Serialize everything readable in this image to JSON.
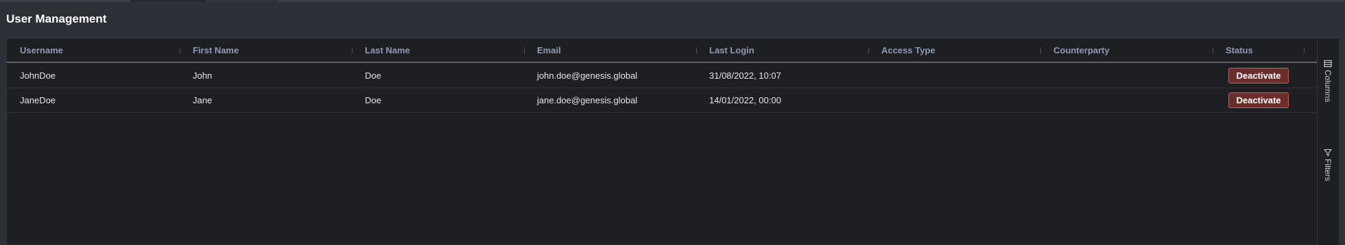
{
  "page": {
    "title": "User Management"
  },
  "grid": {
    "columns": [
      "Username",
      "First Name",
      "Last Name",
      "Email",
      "Last Login",
      "Access Type",
      "Counterparty",
      "Status"
    ],
    "rows": [
      {
        "username": "JohnDoe",
        "first_name": "John",
        "last_name": "Doe",
        "email": "john.doe@genesis.global",
        "last_login": "31/08/2022, 10:07",
        "access_type": "",
        "counterparty": "",
        "status_action": "Deactivate"
      },
      {
        "username": "JaneDoe",
        "first_name": "Jane",
        "last_name": "Doe",
        "email": "jane.doe@genesis.global",
        "last_login": "14/01/2022, 00:00",
        "access_type": "",
        "counterparty": "",
        "status_action": "Deactivate"
      }
    ]
  },
  "side_panel": {
    "columns_label": "Columns",
    "filters_label": "Filters",
    "columns_icon": "columns-icon",
    "filters_icon": "filter-icon"
  },
  "colors": {
    "background": "#2c3037",
    "grid_background": "#1e1f23",
    "header_text": "#8f9bb0",
    "danger_button_bg": "#6b2c2c",
    "danger_button_border": "#d05a50"
  }
}
